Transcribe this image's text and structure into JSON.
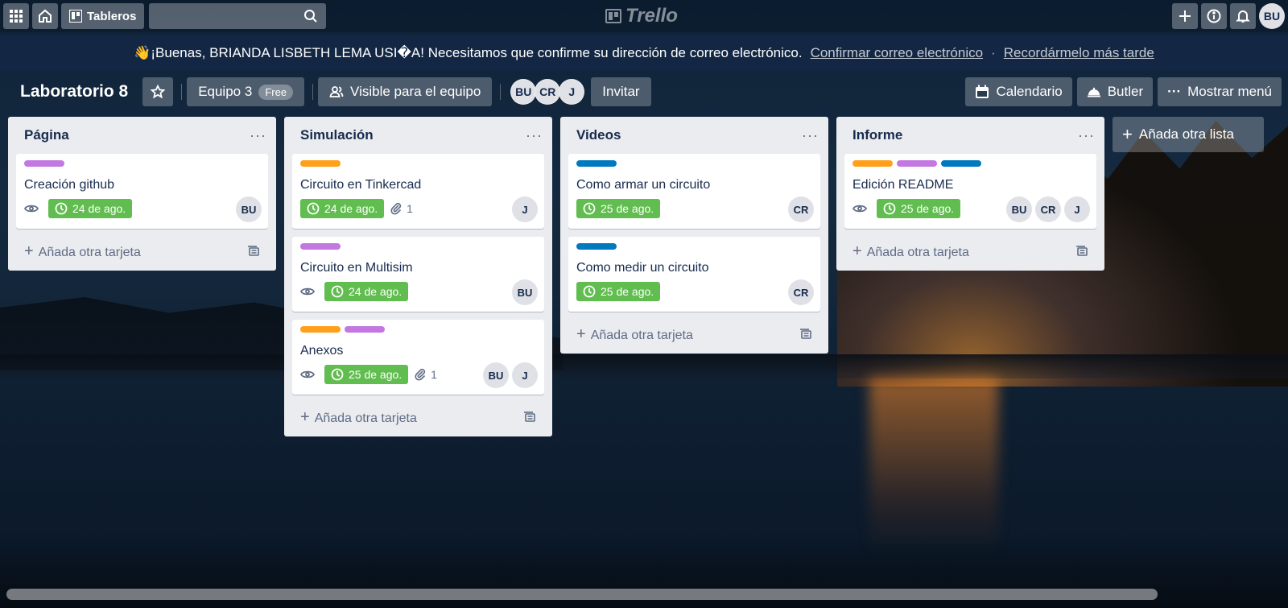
{
  "header": {
    "boards_label": "Tableros",
    "logo_text": "Trello",
    "user_initials": "BU"
  },
  "banner": {
    "emoji": "👋",
    "message": "¡Buenas, BRIANDA LISBETH LEMA USI�A! Necesitamos que confirme su dirección de correo electrónico.",
    "confirm_link": "Confirmar correo electrónico",
    "separator": "·",
    "later_link": "Recordármelo más tarde"
  },
  "board": {
    "title": "Laboratorio 8",
    "team_label": "Equipo 3",
    "team_badge": "Free",
    "visibility_label": "Visible para el equipo",
    "members": [
      "BU",
      "CR",
      "J"
    ],
    "invite_label": "Invitar",
    "calendar_label": "Calendario",
    "butler_label": "Butler",
    "menu_label": "Mostrar menú"
  },
  "colors": {
    "purple": "#c377e0",
    "orange": "#ff9f1a",
    "blue": "#0079bf",
    "green": "#61bd4f"
  },
  "lists": [
    {
      "title": "Página",
      "add_card": "Añada otra tarjeta",
      "cards": [
        {
          "title": "Creación github",
          "labels": [
            "purple"
          ],
          "watch": true,
          "due": "24 de ago.",
          "attachments": "",
          "members": [
            "BU"
          ]
        }
      ]
    },
    {
      "title": "Simulación",
      "add_card": "Añada otra tarjeta",
      "cards": [
        {
          "title": "Circuito en Tinkercad",
          "labels": [
            "orange"
          ],
          "watch": false,
          "due": "24 de ago.",
          "attachments": "1",
          "members": [
            "J"
          ]
        },
        {
          "title": "Circuito en Multisim",
          "labels": [
            "purple"
          ],
          "watch": true,
          "due": "24 de ago.",
          "attachments": "",
          "members": [
            "BU"
          ]
        },
        {
          "title": "Anexos",
          "labels": [
            "orange",
            "purple"
          ],
          "watch": true,
          "due": "25 de ago.",
          "attachments": "1",
          "members": [
            "BU",
            "J"
          ]
        }
      ]
    },
    {
      "title": "Videos",
      "add_card": "Añada otra tarjeta",
      "cards": [
        {
          "title": "Como armar un circuito",
          "labels": [
            "blue"
          ],
          "watch": false,
          "due": "25 de ago.",
          "attachments": "",
          "members": [
            "CR"
          ]
        },
        {
          "title": "Como medir un circuito",
          "labels": [
            "blue"
          ],
          "watch": false,
          "due": "25 de ago.",
          "attachments": "",
          "members": [
            "CR"
          ]
        }
      ]
    },
    {
      "title": "Informe",
      "add_card": "Añada otra tarjeta",
      "cards": [
        {
          "title": "Edición README",
          "labels": [
            "orange",
            "purple",
            "blue"
          ],
          "watch": true,
          "due": "25 de ago.",
          "attachments": "",
          "members": [
            "BU",
            "CR",
            "J"
          ]
        }
      ]
    }
  ],
  "add_list_label": "Añada otra lista"
}
